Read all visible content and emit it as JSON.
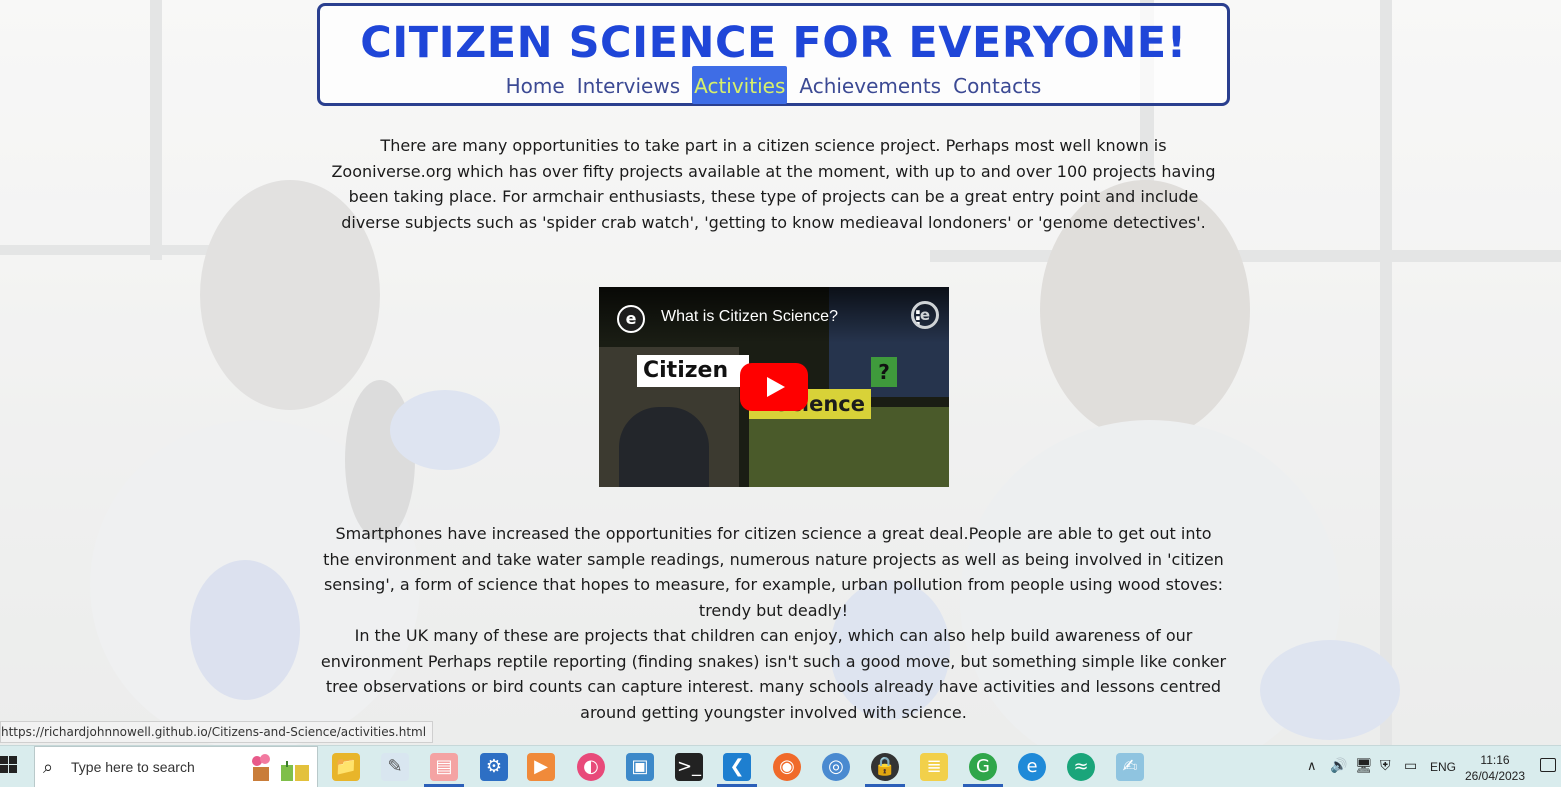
{
  "site": {
    "title": "CITIZEN SCIENCE FOR EVERYONE!",
    "nav": [
      {
        "label": "Home"
      },
      {
        "label": "Interviews"
      },
      {
        "label": "Activities",
        "active": true
      },
      {
        "label": "Achievements"
      },
      {
        "label": "Contacts"
      }
    ]
  },
  "content": {
    "intro": "There are many opportunities to take part in a citizen science project. Perhaps most well known is Zooniverse.org which has over fifty projects available at the moment, with up to and over 100 projects having been taking place. For armchair enthusiasts, these type of projects can be a great entry point and include diverse subjects such as 'spider crab watch', 'getting to know medieaval londoners' or 'genome detectives'.",
    "video": {
      "title": "What is Citizen Science?",
      "overlay_word1": "Citizen",
      "overlay_word2": "Science",
      "overlay_mark": "?",
      "more_glyph": "⋮"
    },
    "smartphones": "Smartphones have increased the opportunities for citizen science a great deal.People are able to get out into the environment and take water sample readings, numerous nature projects as well as being involved in 'citizen sensing', a form of science that hopes to measure, for example, urban pollution from people using wood stoves: trendy but deadly!",
    "uk": "In the UK many of these are projects that children can enjoy, which can also help build awareness of our environment Perhaps reptile reporting (finding snakes) isn't such a good move, but something simple like conker tree observations or bird counts can capture interest. many schools already have activities and lessons centred around getting youngster involved with science."
  },
  "browser": {
    "status_url": "https://richardjohnnowell.github.io/Citizens-and-Science/activities.html"
  },
  "taskbar": {
    "search_placeholder": "Type here to search",
    "pinned": [
      "file-explorer-icon",
      "paint-icon",
      "notes-icon",
      "dev-icon",
      "media-icon",
      "color-icon",
      "remote-icon",
      "terminal-icon",
      "vscode-icon",
      "firefox-icon",
      "network-icon",
      "vpn-icon",
      "python-icon",
      "chrome-icon",
      "edge-icon",
      "app-icon",
      "notepad-icon"
    ],
    "language": "ENG",
    "time": "11:16",
    "date": "26/04/2023"
  },
  "colors": {
    "title": "#1f46d8",
    "nav_text": "#3c4a94",
    "nav_active_bg": "#3e6de6",
    "nav_active_text": "#d7f06a",
    "header_border": "#2a3f8f",
    "youtube_red": "#ff0000"
  }
}
